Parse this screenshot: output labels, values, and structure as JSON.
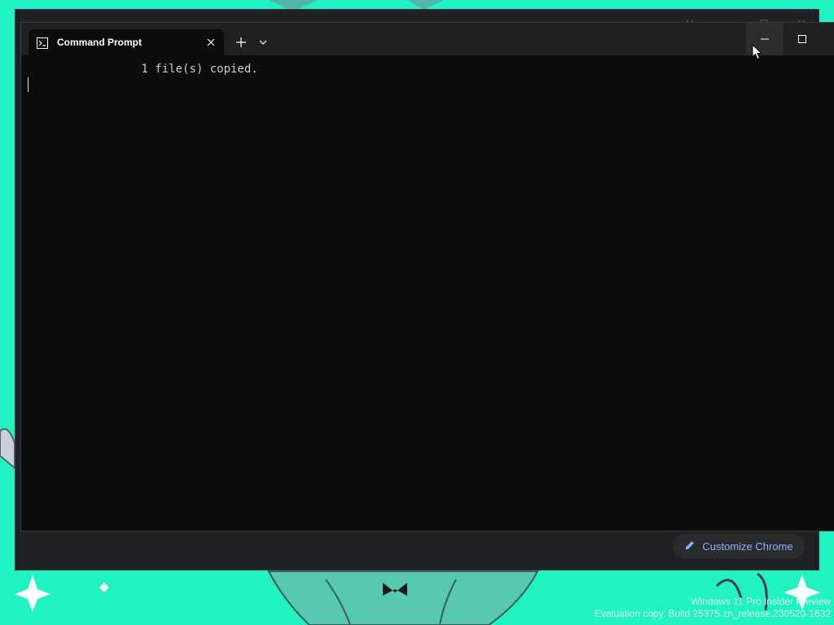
{
  "desktop": {
    "wallpaper_color": "#20f2c2",
    "watermark": {
      "line1": "Windows 11 Pro Insider Preview",
      "line2": "Evaluation copy. Build 25375.zn_release.230520-1632"
    }
  },
  "chrome_window": {
    "customize_button_label": "Customize Chrome",
    "customize_icon": "pencil-icon",
    "accent_color": "#8ab4f8"
  },
  "terminal": {
    "tab": {
      "title": "Command Prompt",
      "icon": "command-prompt-icon"
    },
    "icons": {
      "close": "close-icon",
      "new_tab": "plus-icon",
      "dropdown": "chevron-down-icon",
      "minimize": "minimize-icon",
      "maximize": "maximize-icon"
    },
    "output": [
      "        1 file(s) copied."
    ],
    "background_color": "#0c0c0c",
    "text_color": "#cccccc"
  }
}
